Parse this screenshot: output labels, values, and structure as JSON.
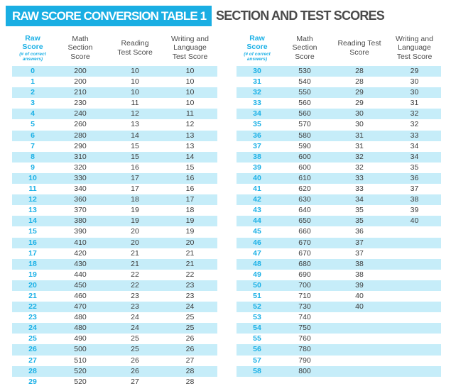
{
  "header": {
    "title": "RAW SCORE CONVERSION TABLE 1",
    "subtitle": "SECTION AND TEST SCORES"
  },
  "colors": {
    "accent": "#1aaee3",
    "stripe": "#c6edf9",
    "raw_score_text": "#1ab0e6",
    "body_text": "#3c3c3c"
  },
  "columns": {
    "left": {
      "raw_line1": "Raw",
      "raw_line2": "Score",
      "raw_sub1": "(# of correct",
      "raw_sub2": "answers)",
      "math_line1": "Math",
      "math_line2": "Section",
      "math_line3": "Score",
      "reading_line1": "Reading",
      "reading_line2": "Test Score",
      "writing_line1": "Writing and",
      "writing_line2": "Language",
      "writing_line3": "Test Score"
    },
    "right": {
      "raw_line1": "Raw",
      "raw_line2": "Score",
      "raw_sub1": "(# of correct",
      "raw_sub2": "answers)",
      "math_line1": "Math",
      "math_line2": "Section",
      "math_line3": "Score",
      "reading_line1": "Reading Test",
      "reading_line2": "Score",
      "writing_line1": "Writing and",
      "writing_line2": "Language",
      "writing_line3": "Test Score"
    }
  },
  "tables": {
    "left": [
      {
        "raw": "0",
        "math": "200",
        "reading": "10",
        "writing": "10"
      },
      {
        "raw": "1",
        "math": "200",
        "reading": "10",
        "writing": "10"
      },
      {
        "raw": "2",
        "math": "210",
        "reading": "10",
        "writing": "10"
      },
      {
        "raw": "3",
        "math": "230",
        "reading": "11",
        "writing": "10"
      },
      {
        "raw": "4",
        "math": "240",
        "reading": "12",
        "writing": "11"
      },
      {
        "raw": "5",
        "math": "260",
        "reading": "13",
        "writing": "12"
      },
      {
        "raw": "6",
        "math": "280",
        "reading": "14",
        "writing": "13"
      },
      {
        "raw": "7",
        "math": "290",
        "reading": "15",
        "writing": "13"
      },
      {
        "raw": "8",
        "math": "310",
        "reading": "15",
        "writing": "14"
      },
      {
        "raw": "9",
        "math": "320",
        "reading": "16",
        "writing": "15"
      },
      {
        "raw": "10",
        "math": "330",
        "reading": "17",
        "writing": "16"
      },
      {
        "raw": "11",
        "math": "340",
        "reading": "17",
        "writing": "16"
      },
      {
        "raw": "12",
        "math": "360",
        "reading": "18",
        "writing": "17"
      },
      {
        "raw": "13",
        "math": "370",
        "reading": "19",
        "writing": "18"
      },
      {
        "raw": "14",
        "math": "380",
        "reading": "19",
        "writing": "19"
      },
      {
        "raw": "15",
        "math": "390",
        "reading": "20",
        "writing": "19"
      },
      {
        "raw": "16",
        "math": "410",
        "reading": "20",
        "writing": "20"
      },
      {
        "raw": "17",
        "math": "420",
        "reading": "21",
        "writing": "21"
      },
      {
        "raw": "18",
        "math": "430",
        "reading": "21",
        "writing": "21"
      },
      {
        "raw": "19",
        "math": "440",
        "reading": "22",
        "writing": "22"
      },
      {
        "raw": "20",
        "math": "450",
        "reading": "22",
        "writing": "23"
      },
      {
        "raw": "21",
        "math": "460",
        "reading": "23",
        "writing": "23"
      },
      {
        "raw": "22",
        "math": "470",
        "reading": "23",
        "writing": "24"
      },
      {
        "raw": "23",
        "math": "480",
        "reading": "24",
        "writing": "25"
      },
      {
        "raw": "24",
        "math": "480",
        "reading": "24",
        "writing": "25"
      },
      {
        "raw": "25",
        "math": "490",
        "reading": "25",
        "writing": "26"
      },
      {
        "raw": "26",
        "math": "500",
        "reading": "25",
        "writing": "26"
      },
      {
        "raw": "27",
        "math": "510",
        "reading": "26",
        "writing": "27"
      },
      {
        "raw": "28",
        "math": "520",
        "reading": "26",
        "writing": "28"
      },
      {
        "raw": "29",
        "math": "520",
        "reading": "27",
        "writing": "28"
      }
    ],
    "right": [
      {
        "raw": "30",
        "math": "530",
        "reading": "28",
        "writing": "29"
      },
      {
        "raw": "31",
        "math": "540",
        "reading": "28",
        "writing": "30"
      },
      {
        "raw": "32",
        "math": "550",
        "reading": "29",
        "writing": "30"
      },
      {
        "raw": "33",
        "math": "560",
        "reading": "29",
        "writing": "31"
      },
      {
        "raw": "34",
        "math": "560",
        "reading": "30",
        "writing": "32"
      },
      {
        "raw": "35",
        "math": "570",
        "reading": "30",
        "writing": "32"
      },
      {
        "raw": "36",
        "math": "580",
        "reading": "31",
        "writing": "33"
      },
      {
        "raw": "37",
        "math": "590",
        "reading": "31",
        "writing": "34"
      },
      {
        "raw": "38",
        "math": "600",
        "reading": "32",
        "writing": "34"
      },
      {
        "raw": "39",
        "math": "600",
        "reading": "32",
        "writing": "35"
      },
      {
        "raw": "40",
        "math": "610",
        "reading": "33",
        "writing": "36"
      },
      {
        "raw": "41",
        "math": "620",
        "reading": "33",
        "writing": "37"
      },
      {
        "raw": "42",
        "math": "630",
        "reading": "34",
        "writing": "38"
      },
      {
        "raw": "43",
        "math": "640",
        "reading": "35",
        "writing": "39"
      },
      {
        "raw": "44",
        "math": "650",
        "reading": "35",
        "writing": "40"
      },
      {
        "raw": "45",
        "math": "660",
        "reading": "36",
        "writing": ""
      },
      {
        "raw": "46",
        "math": "670",
        "reading": "37",
        "writing": ""
      },
      {
        "raw": "47",
        "math": "670",
        "reading": "37",
        "writing": ""
      },
      {
        "raw": "48",
        "math": "680",
        "reading": "38",
        "writing": ""
      },
      {
        "raw": "49",
        "math": "690",
        "reading": "38",
        "writing": ""
      },
      {
        "raw": "50",
        "math": "700",
        "reading": "39",
        "writing": ""
      },
      {
        "raw": "51",
        "math": "710",
        "reading": "40",
        "writing": ""
      },
      {
        "raw": "52",
        "math": "730",
        "reading": "40",
        "writing": ""
      },
      {
        "raw": "53",
        "math": "740",
        "reading": "",
        "writing": ""
      },
      {
        "raw": "54",
        "math": "750",
        "reading": "",
        "writing": ""
      },
      {
        "raw": "55",
        "math": "760",
        "reading": "",
        "writing": ""
      },
      {
        "raw": "56",
        "math": "780",
        "reading": "",
        "writing": ""
      },
      {
        "raw": "57",
        "math": "790",
        "reading": "",
        "writing": ""
      },
      {
        "raw": "58",
        "math": "800",
        "reading": "",
        "writing": ""
      }
    ]
  }
}
